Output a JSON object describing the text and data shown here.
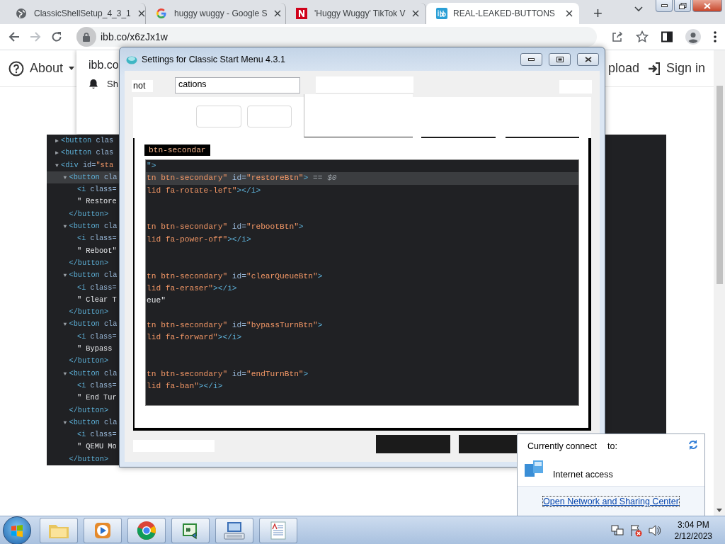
{
  "browser": {
    "tabs": [
      {
        "title": "ClassicShellSetup_4_3_1",
        "selected": false
      },
      {
        "title": "huggy wuggy - Google S",
        "selected": false
      },
      {
        "title": "'Huggy Wuggy' TikTok V",
        "selected": false
      },
      {
        "title": "REAL-LEAKED-BUTTONS",
        "selected": true
      }
    ],
    "new_tab": "+",
    "address": "ibb.co/x6zJx1w",
    "page": {
      "about": "About",
      "upload": "pload",
      "sign_in": "Sign in"
    },
    "notification": {
      "site": "ibb.co",
      "text": "Sh"
    },
    "devtools": {
      "nodes": [
        {
          "arrow": "▶",
          "selected": false,
          "tokens": [
            {
              "text": "<button",
              "kind": "tag"
            },
            {
              "text": " clas",
              "kind": "attr"
            }
          ]
        },
        {
          "arrow": "▶",
          "selected": false,
          "tokens": [
            {
              "text": "<button",
              "kind": "tag"
            },
            {
              "text": " clas",
              "kind": "attr"
            }
          ]
        },
        {
          "arrow": "▼",
          "selected": false,
          "tokens": [
            {
              "text": "<div",
              "kind": "tag"
            },
            {
              "text": " id=",
              "kind": "attr"
            },
            {
              "text": "\"sta",
              "kind": "value"
            }
          ],
          "children": [
            {
              "arrow": "▼",
              "selected": true,
              "tokens": [
                {
                  "text": "<button",
                  "kind": "tag"
                },
                {
                  "text": " cla",
                  "kind": "attr"
                }
              ],
              "children": [
                {
                  "selected": false,
                  "tokens": [
                    {
                      "text": "<i",
                      "kind": "tag"
                    },
                    {
                      "text": " class=",
                      "kind": "attr"
                    }
                  ]
                },
                {
                  "selected": false,
                  "tokens": [
                    {
                      "text": "\" Restore",
                      "kind": "text"
                    }
                  ]
                }
              ],
              "closing": [
                {
                  "text": "</button>",
                  "kind": "tag"
                }
              ]
            },
            {
              "arrow": "▼",
              "selected": false,
              "tokens": [
                {
                  "text": "<button",
                  "kind": "tag"
                },
                {
                  "text": " cla",
                  "kind": "attr"
                }
              ],
              "children": [
                {
                  "selected": false,
                  "tokens": [
                    {
                      "text": "<i",
                      "kind": "tag"
                    },
                    {
                      "text": " class=",
                      "kind": "attr"
                    }
                  ]
                },
                {
                  "selected": false,
                  "tokens": [
                    {
                      "text": "\" Reboot\"",
                      "kind": "text"
                    }
                  ]
                }
              ],
              "closing": [
                {
                  "text": "</button>",
                  "kind": "tag"
                }
              ]
            },
            {
              "arrow": "▼",
              "selected": false,
              "tokens": [
                {
                  "text": "<button",
                  "kind": "tag"
                },
                {
                  "text": " cla",
                  "kind": "attr"
                }
              ],
              "children": [
                {
                  "selected": false,
                  "tokens": [
                    {
                      "text": "<i",
                      "kind": "tag"
                    },
                    {
                      "text": " class=",
                      "kind": "attr"
                    }
                  ]
                },
                {
                  "selected": false,
                  "tokens": [
                    {
                      "text": "\" Clear T",
                      "kind": "text"
                    }
                  ]
                }
              ],
              "closing": [
                {
                  "text": "</button>",
                  "kind": "tag"
                }
              ]
            },
            {
              "arrow": "▼",
              "selected": false,
              "tokens": [
                {
                  "text": "<button",
                  "kind": "tag"
                },
                {
                  "text": " cla",
                  "kind": "attr"
                }
              ],
              "children": [
                {
                  "selected": false,
                  "tokens": [
                    {
                      "text": "<i",
                      "kind": "tag"
                    },
                    {
                      "text": " class=",
                      "kind": "attr"
                    }
                  ]
                },
                {
                  "selected": false,
                  "tokens": [
                    {
                      "text": "\" Bypass",
                      "kind": "text"
                    }
                  ]
                }
              ],
              "closing": [
                {
                  "text": "</button>",
                  "kind": "tag"
                }
              ]
            },
            {
              "arrow": "▼",
              "selected": false,
              "tokens": [
                {
                  "text": "<button",
                  "kind": "tag"
                },
                {
                  "text": " cla",
                  "kind": "attr"
                }
              ],
              "children": [
                {
                  "selected": false,
                  "tokens": [
                    {
                      "text": "<i",
                      "kind": "tag"
                    },
                    {
                      "text": " class=",
                      "kind": "attr"
                    }
                  ]
                },
                {
                  "selected": false,
                  "tokens": [
                    {
                      "text": "\" End Tur",
                      "kind": "text"
                    }
                  ]
                }
              ],
              "closing": [
                {
                  "text": "</button>",
                  "kind": "tag"
                }
              ]
            },
            {
              "arrow": "▼",
              "selected": false,
              "tokens": [
                {
                  "text": "<button",
                  "kind": "tag"
                },
                {
                  "text": " cla",
                  "kind": "attr"
                }
              ],
              "children": [
                {
                  "selected": false,
                  "tokens": [
                    {
                      "text": "<i",
                      "kind": "tag"
                    },
                    {
                      "text": " class=",
                      "kind": "attr"
                    }
                  ]
                },
                {
                  "selected": false,
                  "tokens": [
                    {
                      "text": "\" QEMU Mo",
                      "kind": "text"
                    }
                  ]
                }
              ],
              "closing": [
                {
                  "text": "</button>",
                  "kind": "tag"
                }
              ]
            }
          ]
        }
      ]
    }
  },
  "dialog": {
    "title": "Settings for Classic Start Menu 4.3.1",
    "label": "not",
    "field_value": "cations",
    "tag": "btn-secondar",
    "code_lines": [
      {
        "kind": "code",
        "selected": false,
        "tokens": [
          {
            "text": "\">",
            "kind": "tag"
          }
        ]
      },
      {
        "kind": "code",
        "selected": true,
        "tokens": [
          {
            "text": "tn btn-secondary\"",
            "kind": "value"
          },
          {
            "text": " id=",
            "kind": "attr"
          },
          {
            "text": "\"restoreBtn\"",
            "kind": "value"
          },
          {
            "text": ">",
            "kind": "tag"
          },
          {
            "text": " == $0",
            "kind": "dim"
          }
        ]
      },
      {
        "kind": "code",
        "selected": false,
        "tokens": [
          {
            "text": "lid fa-rotate-left\"",
            "kind": "value"
          },
          {
            "text": "></i>",
            "kind": "tag"
          }
        ]
      },
      {
        "kind": "blank",
        "selected": false
      },
      {
        "kind": "blank",
        "selected": false
      },
      {
        "kind": "code",
        "selected": false,
        "tokens": [
          {
            "text": "tn btn-secondary\"",
            "kind": "value"
          },
          {
            "text": " id=",
            "kind": "attr"
          },
          {
            "text": "\"rebootBtn\"",
            "kind": "value"
          },
          {
            "text": ">",
            "kind": "tag"
          }
        ]
      },
      {
        "kind": "code",
        "selected": false,
        "tokens": [
          {
            "text": "lid fa-power-off\"",
            "kind": "value"
          },
          {
            "text": "></i>",
            "kind": "tag"
          }
        ]
      },
      {
        "kind": "blank",
        "selected": false
      },
      {
        "kind": "blank",
        "selected": false
      },
      {
        "kind": "code",
        "selected": false,
        "tokens": [
          {
            "text": "tn btn-secondary\"",
            "kind": "value"
          },
          {
            "text": " id=",
            "kind": "attr"
          },
          {
            "text": "\"clearQueueBtn\"",
            "kind": "value"
          },
          {
            "text": ">",
            "kind": "tag"
          }
        ]
      },
      {
        "kind": "code",
        "selected": false,
        "tokens": [
          {
            "text": "lid fa-eraser\"",
            "kind": "value"
          },
          {
            "text": "></i>",
            "kind": "tag"
          }
        ]
      },
      {
        "kind": "code",
        "selected": false,
        "tokens": [
          {
            "text": "eue\"",
            "kind": "text"
          }
        ]
      },
      {
        "kind": "blank",
        "selected": false
      },
      {
        "kind": "code",
        "selected": false,
        "tokens": [
          {
            "text": "tn btn-secondary\"",
            "kind": "value"
          },
          {
            "text": " id=",
            "kind": "attr"
          },
          {
            "text": "\"bypassTurnBtn\"",
            "kind": "value"
          },
          {
            "text": ">",
            "kind": "tag"
          }
        ]
      },
      {
        "kind": "code",
        "selected": false,
        "tokens": [
          {
            "text": "lid fa-forward\"",
            "kind": "value"
          },
          {
            "text": "></i>",
            "kind": "tag"
          }
        ]
      },
      {
        "kind": "blank",
        "selected": false
      },
      {
        "kind": "blank",
        "selected": false
      },
      {
        "kind": "code",
        "selected": false,
        "tokens": [
          {
            "text": "tn btn-secondary\"",
            "kind": "value"
          },
          {
            "text": " id=",
            "kind": "attr"
          },
          {
            "text": "\"endTurnBtn\"",
            "kind": "value"
          },
          {
            "text": ">",
            "kind": "tag"
          }
        ]
      },
      {
        "kind": "code",
        "selected": false,
        "tokens": [
          {
            "text": "lid fa-ban\"",
            "kind": "value"
          },
          {
            "text": "></i>",
            "kind": "tag"
          }
        ]
      }
    ]
  },
  "network_popup": {
    "heading": "Currently connect",
    "heading_end": "to:",
    "status": "Internet access",
    "link": "Open Network and Sharing Center"
  },
  "taskbar": {
    "time": "3:04 PM",
    "date": "2/12/2023"
  }
}
